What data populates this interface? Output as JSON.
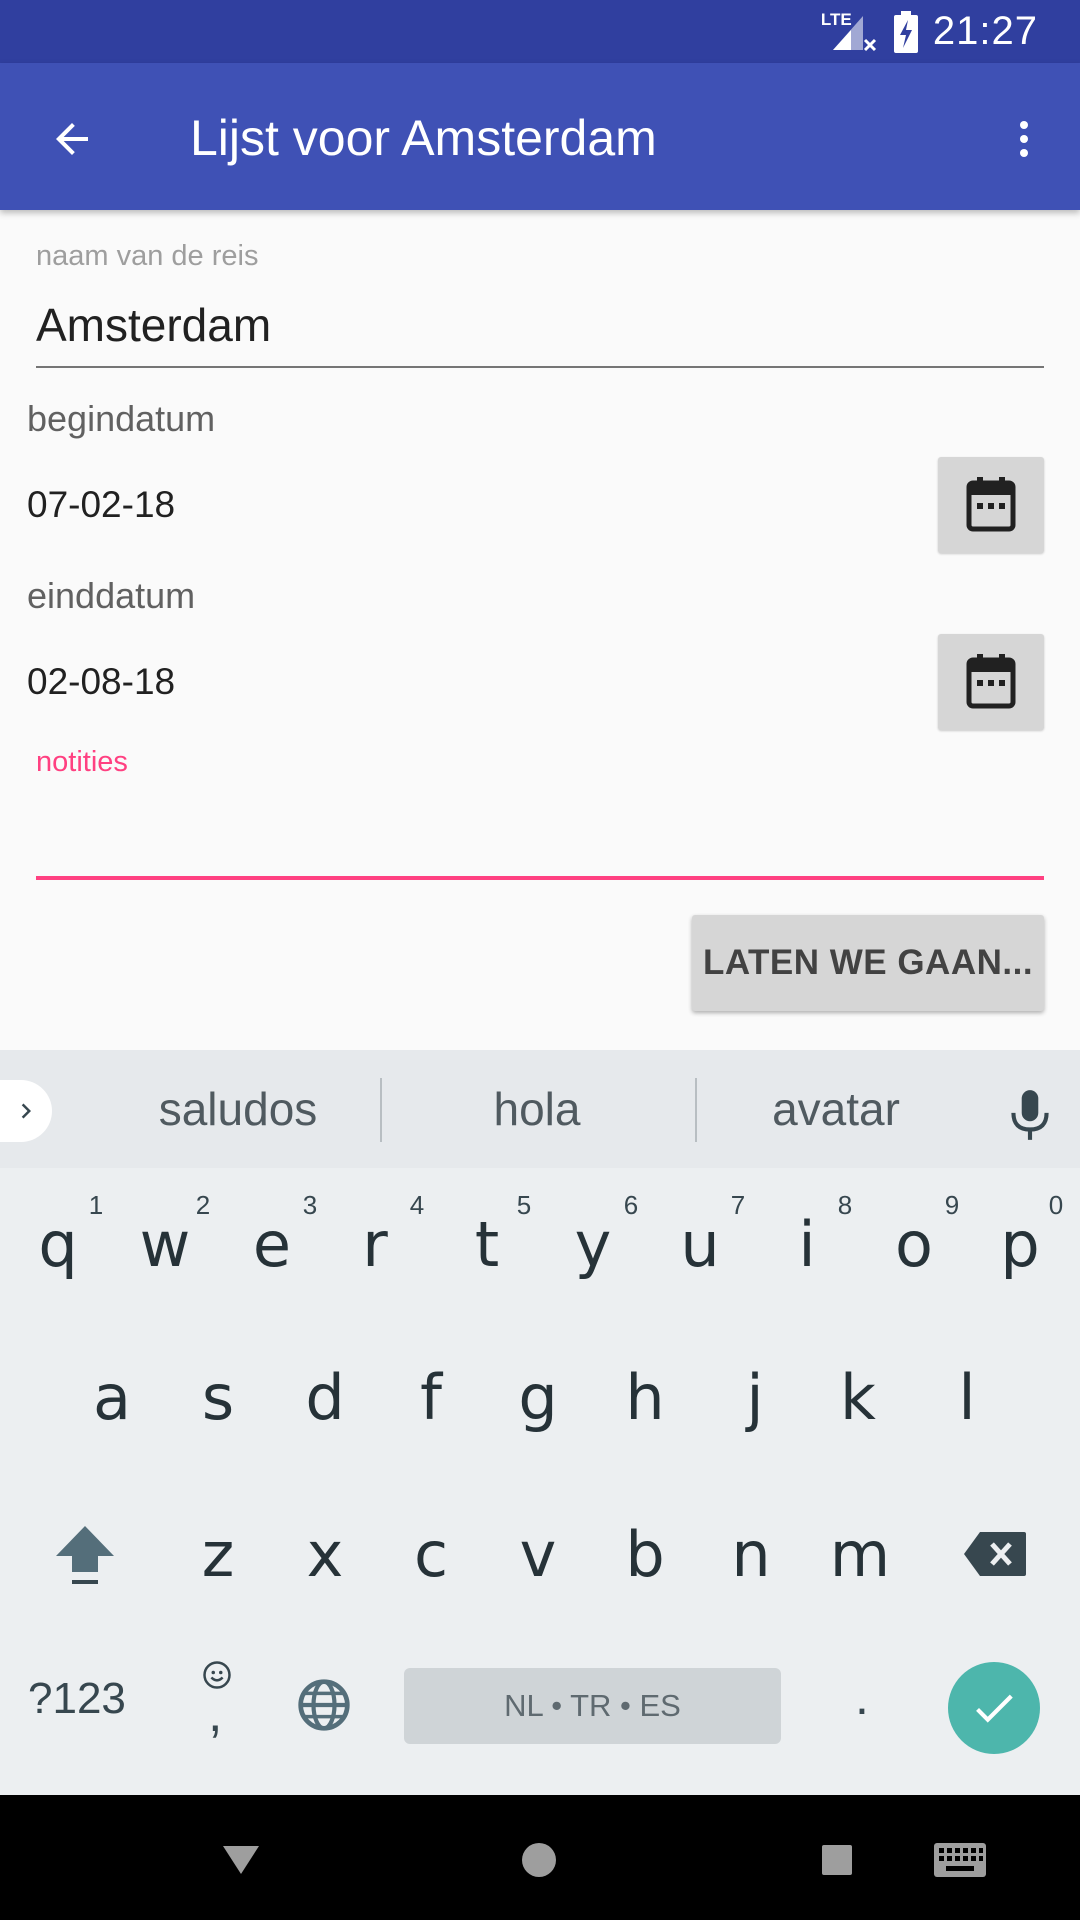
{
  "status_bar": {
    "time": "21:27",
    "network": "LTE",
    "signal_icon": "signal-no-data-icon",
    "battery_icon": "battery-charging-icon"
  },
  "app_bar": {
    "title": "Lijst voor Amsterdam",
    "back_icon": "arrow-back-icon",
    "menu_icon": "more-vert-icon"
  },
  "form": {
    "trip_name": {
      "label": "naam van de reis",
      "value": "Amsterdam"
    },
    "start_date": {
      "label": "begindatum",
      "value": "07-02-18",
      "button_icon": "calendar-icon"
    },
    "end_date": {
      "label": "einddatum",
      "value": "02-08-18",
      "button_icon": "calendar-icon"
    },
    "notes": {
      "label": "notities",
      "value": ""
    },
    "submit_label": "LATEN WE GAAN..."
  },
  "keyboard": {
    "suggestions": [
      "saludos",
      "hola",
      "avatar"
    ],
    "row1": [
      "q",
      "w",
      "e",
      "r",
      "t",
      "y",
      "u",
      "i",
      "o",
      "p"
    ],
    "row1_hints": [
      "1",
      "2",
      "3",
      "4",
      "5",
      "6",
      "7",
      "8",
      "9",
      "0"
    ],
    "row2": [
      "a",
      "s",
      "d",
      "f",
      "g",
      "h",
      "j",
      "k",
      "l"
    ],
    "row3": [
      "z",
      "x",
      "c",
      "v",
      "b",
      "n",
      "m"
    ],
    "symbols_label": "?123",
    "comma_label": ",",
    "period_label": ".",
    "space_label": "NL • TR • ES",
    "icons": {
      "expand": "chevron-right-icon",
      "mic": "mic-icon",
      "shift": "shift-icon",
      "backspace": "backspace-icon",
      "emoji": "emoji-icon",
      "language": "globe-icon",
      "enter": "check-icon"
    }
  },
  "colors": {
    "primary": "#3f51b5",
    "primary_dark": "#303f9f",
    "accent": "#ff4081",
    "keyboard_enter": "#4db6ac"
  },
  "nav_bar": {
    "icons": [
      "back-triangle-icon",
      "home-circle-icon",
      "recents-square-icon",
      "keyboard-icon"
    ]
  }
}
